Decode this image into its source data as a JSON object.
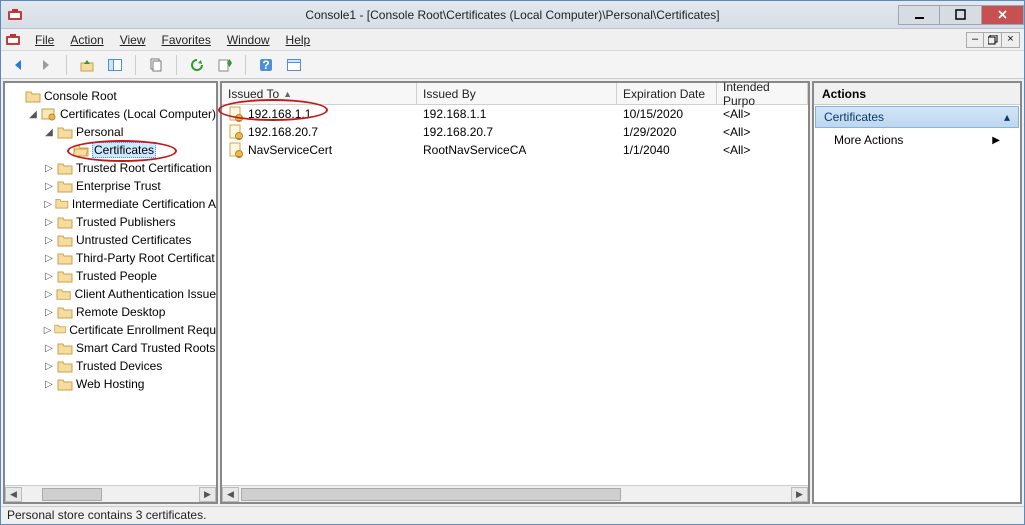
{
  "window": {
    "title": "Console1 - [Console Root\\Certificates (Local Computer)\\Personal\\Certificates]"
  },
  "menu": {
    "file": "File",
    "action": "Action",
    "view": "View",
    "favorites": "Favorites",
    "window": "Window",
    "help": "Help"
  },
  "tree": {
    "root": "Console Root",
    "certs": "Certificates (Local Computer)",
    "personal": "Personal",
    "certificates_node": "Certificates",
    "items": [
      "Trusted Root Certification",
      "Enterprise Trust",
      "Intermediate Certification A",
      "Trusted Publishers",
      "Untrusted Certificates",
      "Third-Party Root Certificat",
      "Trusted People",
      "Client Authentication Issue",
      "Remote Desktop",
      "Certificate Enrollment Requ",
      "Smart Card Trusted Roots",
      "Trusted Devices",
      "Web Hosting"
    ]
  },
  "columns": {
    "issued_to": "Issued To",
    "issued_by": "Issued By",
    "expiry": "Expiration Date",
    "intended": "Intended Purpo"
  },
  "rows": [
    {
      "issued_to": "192.168.1.1",
      "issued_by": "192.168.1.1",
      "expiry": "10/15/2020",
      "intended": "<All>"
    },
    {
      "issued_to": "192.168.20.7",
      "issued_by": "192.168.20.7",
      "expiry": "1/29/2020",
      "intended": "<All>"
    },
    {
      "issued_to": "NavServiceCert",
      "issued_by": "RootNavServiceCA",
      "expiry": "1/1/2040",
      "intended": "<All>"
    }
  ],
  "actions": {
    "header": "Actions",
    "section": "Certificates",
    "more": "More Actions"
  },
  "status": "Personal store contains 3 certificates."
}
